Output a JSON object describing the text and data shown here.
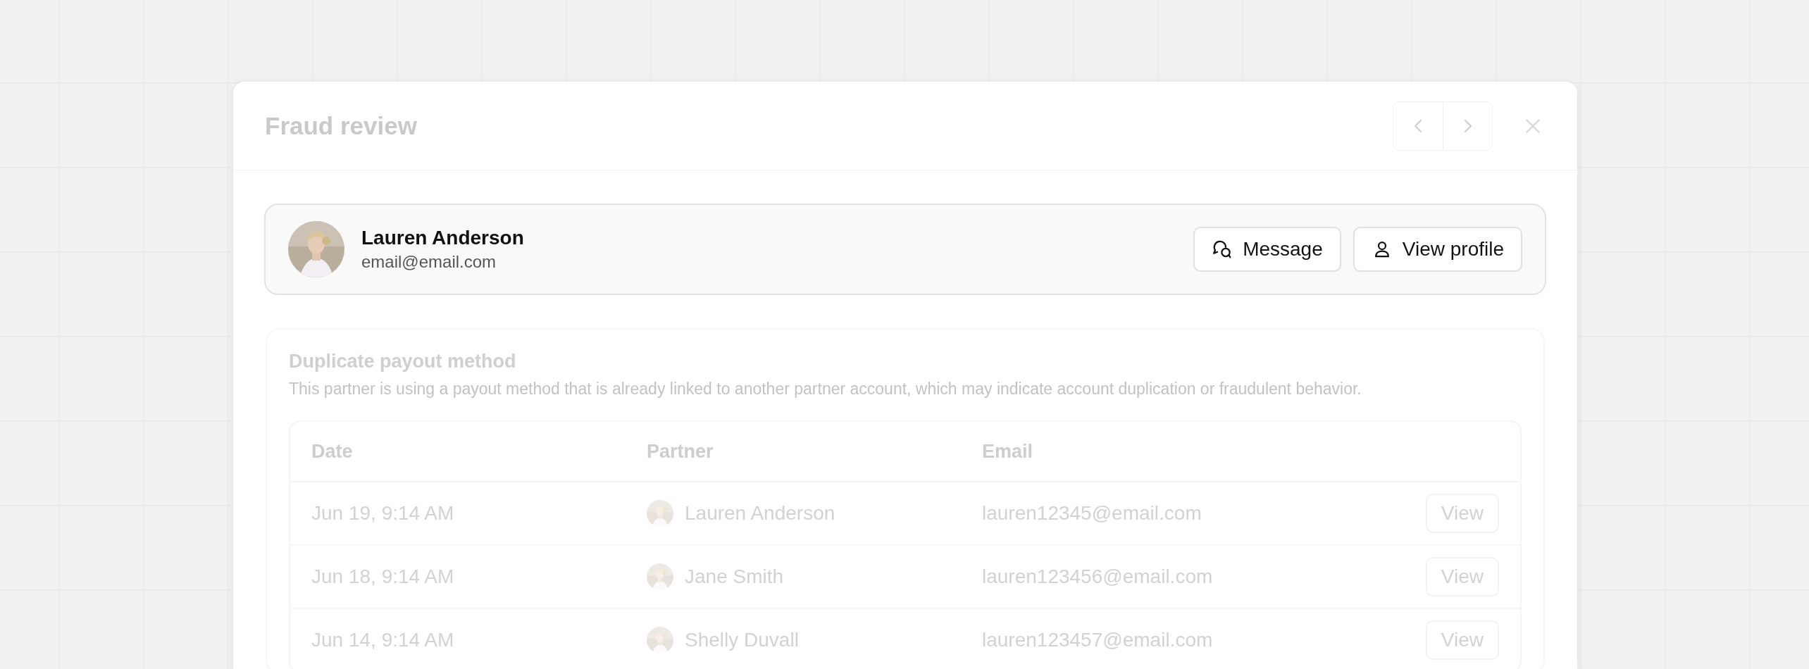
{
  "window": {
    "title": "Fraud review"
  },
  "profile": {
    "name": "Lauren Anderson",
    "email": "email@email.com",
    "actions": [
      {
        "label": "Message",
        "kind": "message"
      },
      {
        "label": "View profile",
        "kind": "profile"
      }
    ]
  },
  "section": {
    "title": "Duplicate payout method",
    "description": "This partner is using a payout method that is already linked to another partner account, which may indicate account duplication or fraudulent behavior.",
    "table": {
      "columns": [
        "Date",
        "Partner",
        "Email"
      ],
      "rows": [
        {
          "date": "Jun 19, 9:14 AM",
          "partner": "Lauren Anderson",
          "email": "lauren12345@email.com",
          "action": "View"
        },
        {
          "date": "Jun 18, 9:14 AM",
          "partner": "Jane Smith",
          "email": "lauren123456@email.com",
          "action": "View"
        },
        {
          "date": "Jun 14, 9:14 AM",
          "partner": "Shelly Duvall",
          "email": "lauren123457@email.com",
          "action": "View"
        }
      ]
    }
  }
}
